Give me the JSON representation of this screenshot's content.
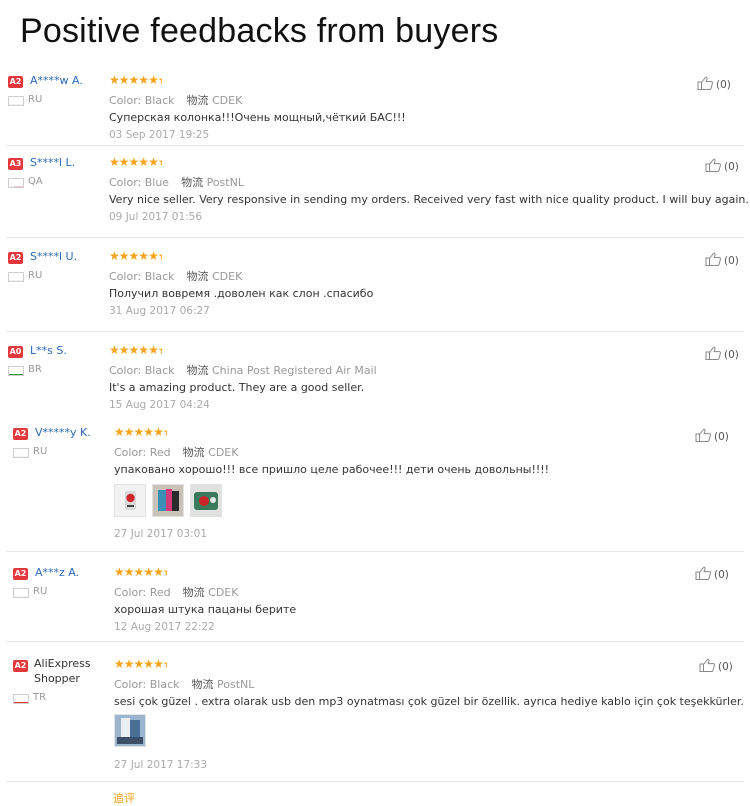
{
  "page": {
    "title": "Positive feedbacks from buyers"
  },
  "colors": {
    "star": "#f7a31c",
    "badge": "#e4393c",
    "buyer_name": "#2a6ab7"
  },
  "reviews": [
    {
      "badge": "A2",
      "buyer": "A****w A.",
      "country": "RU",
      "flag_icon": "russia-flag-icon",
      "rating": 5,
      "color_label": "Color:",
      "color_value": "Black",
      "logistics_label": "物流",
      "logistics_value": "CDEK",
      "content": "Суперская колонка!!!Очень мощный,чёткий БАС!!!",
      "date": "03 Sep 2017 19:25",
      "helpful": "(0)"
    },
    {
      "badge": "A3",
      "buyer": "S****l L.",
      "country": "QA",
      "flag_icon": "qatar-flag-icon",
      "rating": 5,
      "color_label": "Color:",
      "color_value": "Blue",
      "logistics_label": "物流",
      "logistics_value": "PostNL",
      "content": "Very nice seller. Very responsive in sending my orders. Received very fast with nice quality product. I will buy again.",
      "date": "09 Jul 2017 01:56",
      "helpful": "(0)"
    },
    {
      "badge": "A2",
      "buyer": "S****l U.",
      "country": "RU",
      "flag_icon": "russia-flag-icon",
      "rating": 5,
      "color_label": "Color:",
      "color_value": "Black",
      "logistics_label": "物流",
      "logistics_value": "CDEK",
      "content": "Получил вовремя .доволен как слон .спасибо",
      "date": "31 Aug 2017 06:27",
      "helpful": "(0)"
    },
    {
      "badge": "A0",
      "buyer": "L**s S.",
      "country": "BR",
      "flag_icon": "brazil-flag-icon",
      "rating": 5,
      "color_label": "Color:",
      "color_value": "Black",
      "logistics_label": "物流",
      "logistics_value": "China Post Registered Air Mail",
      "content": "It's a amazing product. They are a good seller.",
      "date": "15 Aug 2017 04:24",
      "helpful": "(0)"
    },
    {
      "badge": "A2",
      "buyer": "V*****y K.",
      "country": "RU",
      "flag_icon": "russia-flag-icon",
      "rating": 5,
      "color_label": "Color:",
      "color_value": "Red",
      "logistics_label": "物流",
      "logistics_value": "CDEK",
      "content": "упаковано хорошо!!! все пришло целе рабочее!!! дети очень довольны!!!!",
      "date": "27 Jul 2017 03:01",
      "helpful": "(0)"
    },
    {
      "badge": "A2",
      "buyer": "A***z A.",
      "country": "RU",
      "flag_icon": "russia-flag-icon",
      "rating": 5,
      "color_label": "Color:",
      "color_value": "Red",
      "logistics_label": "物流",
      "logistics_value": "CDEK",
      "content": "хорошая штука пацаны берите",
      "date": "12 Aug 2017 22:22",
      "helpful": "(0)"
    },
    {
      "badge": "A2",
      "buyer": "AliExpress Shopper",
      "country": "TR",
      "flag_icon": "turkey-flag-icon",
      "rating": 5,
      "color_label": "Color:",
      "color_value": "Black",
      "logistics_label": "物流",
      "logistics_value": "PostNL",
      "content": "sesi çok güzel . extra olarak usb den mp3 oynatması çok güzel bir özellik. ayrıca hediye kablo için çok teşekkürler.",
      "date": "27 Jul 2017 17:33",
      "helpful": "(0)"
    }
  ],
  "footer": {
    "partial_text": "追评"
  }
}
